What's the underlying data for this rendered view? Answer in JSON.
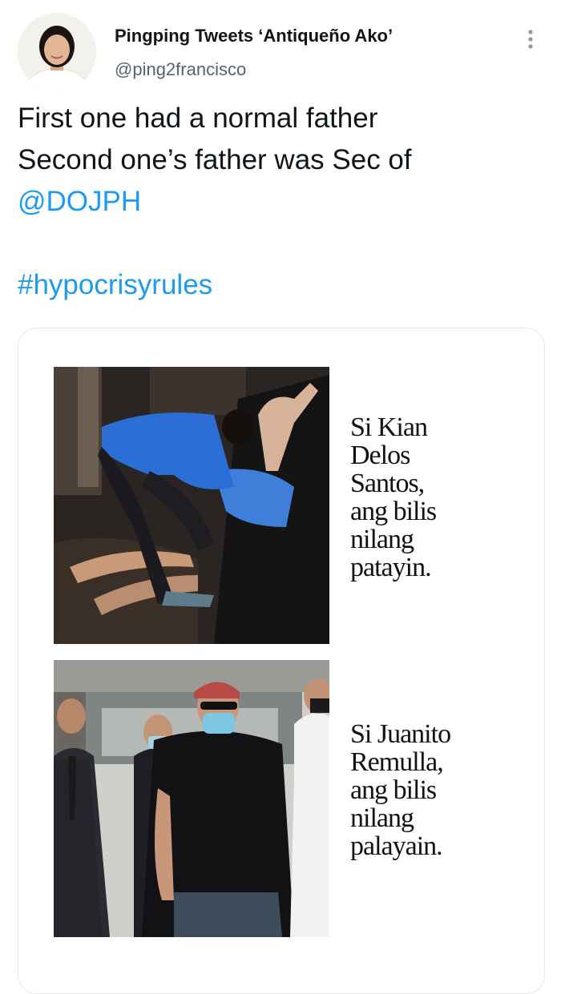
{
  "tweet": {
    "author_name": "Pingping Tweets ‘Antiqueño Ako’",
    "author_handle": "@ping2francisco",
    "more_icon": "more-vertical-icon",
    "text_line_1": "First one had a normal father",
    "text_line_2": "Second one’s father was Sec of",
    "mention": "@DOJPH",
    "hashtag": "#hypocrisyrules"
  },
  "media": {
    "panels": [
      {
        "caption_lines": [
          "Si Kian",
          "Delos",
          "Santos,",
          "ang bilis",
          "nilang",
          "patayin."
        ]
      },
      {
        "caption_lines": [
          "Si Juanito",
          "Remulla,",
          "ang bilis",
          "nilang",
          "palayain."
        ]
      }
    ]
  },
  "colors": {
    "link": "#1d9bf0",
    "text": "#0f1419",
    "secondary_text": "#536471",
    "card_border": "#e6e9eb"
  }
}
